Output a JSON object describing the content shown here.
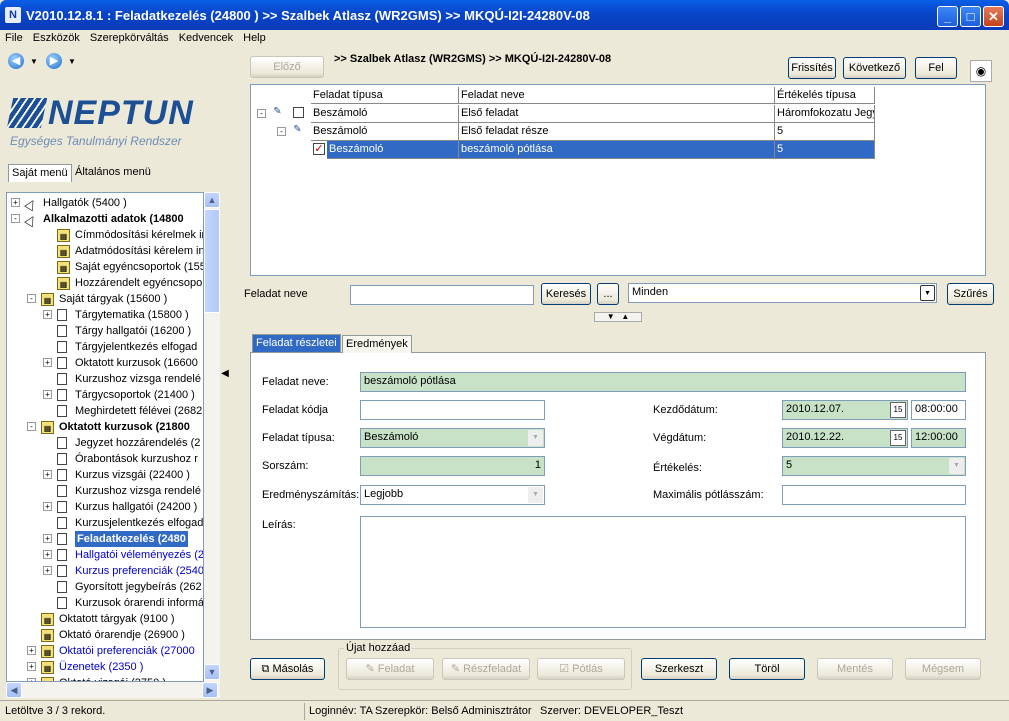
{
  "window": {
    "title": "V2010.12.8.1 : Feladatkezelés (24800  )  >> Szalbek Atlasz (WR2GMS) >> MKQÚ-I2I-24280V-08",
    "app_icon": "N",
    "controls": {
      "minimize": "_",
      "maximize": "□",
      "close": "✕"
    }
  },
  "menubar": [
    "File",
    "Eszközök",
    "Szerepkörváltás",
    "Kedvencek",
    "Help"
  ],
  "logo": {
    "name": "NEPTUN",
    "tagline": "Egységes Tanulmányi Rendszer"
  },
  "left_tabs": [
    "Saját menü",
    "Általános menü"
  ],
  "tree": [
    {
      "text": "Hallgatók (5400  )",
      "level": 0,
      "pm": "+",
      "icon": "book",
      "style": ""
    },
    {
      "text": "Alkalmazotti adatok (14800",
      "level": 0,
      "pm": "-",
      "icon": "book",
      "style": "bold"
    },
    {
      "text": "Címmódosítási kérelmek indít",
      "level": 2,
      "pm": "",
      "icon": "key",
      "style": ""
    },
    {
      "text": "Adatmódosítási kérelem indít",
      "level": 2,
      "pm": "",
      "icon": "key",
      "style": ""
    },
    {
      "text": "Saját egyéncsoportok (15500",
      "level": 2,
      "pm": "",
      "icon": "key",
      "style": ""
    },
    {
      "text": "Hozzárendelt egyéncsoportok",
      "level": 2,
      "pm": "",
      "icon": "key",
      "style": ""
    },
    {
      "text": "Saját tárgyak (15600  )",
      "level": 1,
      "pm": "-",
      "icon": "key",
      "style": ""
    },
    {
      "text": "Tárgytematika (15800  )",
      "level": 2,
      "pm": "+",
      "icon": "doc",
      "style": ""
    },
    {
      "text": "Tárgy hallgatói (16200  )",
      "level": 2,
      "pm": "",
      "icon": "doc",
      "style": ""
    },
    {
      "text": "Tárgyjelentkezés elfogad",
      "level": 2,
      "pm": "",
      "icon": "doc",
      "style": ""
    },
    {
      "text": "Oktatott kurzusok (16600",
      "level": 2,
      "pm": "+",
      "icon": "doc",
      "style": ""
    },
    {
      "text": "Kurzushoz vizsga rendelé",
      "level": 2,
      "pm": "",
      "icon": "doc",
      "style": ""
    },
    {
      "text": "Tárgycsoportok (21400  )",
      "level": 2,
      "pm": "+",
      "icon": "doc",
      "style": ""
    },
    {
      "text": "Meghirdetett félévei (2682",
      "level": 2,
      "pm": "",
      "icon": "doc",
      "style": ""
    },
    {
      "text": "Oktatott kurzusok (21800",
      "level": 1,
      "pm": "-",
      "icon": "key",
      "style": "bold"
    },
    {
      "text": "Jegyzet hozzárendelés (2",
      "level": 2,
      "pm": "",
      "icon": "doc",
      "style": ""
    },
    {
      "text": "Órabontások kurzushoz r",
      "level": 2,
      "pm": "",
      "icon": "doc",
      "style": ""
    },
    {
      "text": "Kurzus vizsgái (22400  )",
      "level": 2,
      "pm": "+",
      "icon": "doc",
      "style": ""
    },
    {
      "text": "Kurzushoz vizsga rendelé",
      "level": 2,
      "pm": "",
      "icon": "doc",
      "style": ""
    },
    {
      "text": "Kurzus hallgatói (24200  )",
      "level": 2,
      "pm": "+",
      "icon": "doc",
      "style": ""
    },
    {
      "text": "Kurzusjelentkezés elfogad",
      "level": 2,
      "pm": "",
      "icon": "doc",
      "style": ""
    },
    {
      "text": "Feladatkezelés (2480",
      "level": 2,
      "pm": "+",
      "icon": "doc",
      "style": "hl"
    },
    {
      "text": "Hallgatói véleményezés (2",
      "level": 2,
      "pm": "+",
      "icon": "doc",
      "style": "blue"
    },
    {
      "text": "Kurzus preferenciák (2540",
      "level": 2,
      "pm": "+",
      "icon": "doc",
      "style": "blue"
    },
    {
      "text": "Gyorsított jegybeírás (262",
      "level": 2,
      "pm": "",
      "icon": "doc",
      "style": ""
    },
    {
      "text": "Kurzusok órarendi informá",
      "level": 2,
      "pm": "",
      "icon": "doc",
      "style": ""
    },
    {
      "text": "Oktatott tárgyak (9100  )",
      "level": 1,
      "pm": "",
      "icon": "key",
      "style": ""
    },
    {
      "text": "Oktató órarendje (26900  )",
      "level": 1,
      "pm": "",
      "icon": "key",
      "style": ""
    },
    {
      "text": "Oktatói preferenciák (27000",
      "level": 1,
      "pm": "+",
      "icon": "key",
      "style": "blue"
    },
    {
      "text": "Üzenetek (2350  )",
      "level": 1,
      "pm": "+",
      "icon": "key",
      "style": "blue"
    },
    {
      "text": "Oktató vizsgái (2750  )",
      "level": 1,
      "pm": "+",
      "icon": "key",
      "style": ""
    }
  ],
  "toolbar": {
    "prev": "Előző",
    "breadcrumb": ">> Szalbek Atlasz (WR2GMS) >> MKQÚ-I2I-24280V-08",
    "refresh": "Frissítés",
    "next": "Következő",
    "up": "Fel"
  },
  "grid": {
    "headers": [
      "Feladat típusa",
      "Feladat neve",
      "Értékelés típusa"
    ],
    "rows": [
      {
        "type": "Beszámoló",
        "name": "Első feladat",
        "eval": "Háromfokozatu Jegy",
        "selected": false
      },
      {
        "type": "Beszámoló",
        "name": "Első feladat része",
        "eval": "5",
        "selected": false
      },
      {
        "type": "Beszámoló",
        "name": "beszámoló pótlása",
        "eval": "5",
        "selected": true
      }
    ]
  },
  "filter": {
    "label": "Feladat neve",
    "value": "",
    "search": "Keresés",
    "ellipsis": "...",
    "scope": "Minden",
    "filter_btn": "Szűrés"
  },
  "detail_tabs": [
    "Feladat részletei",
    "Eredmények"
  ],
  "form": {
    "name_label": "Feladat neve:",
    "name_value": "beszámoló pótlása",
    "code_label": "Feladat kódja",
    "code_value": "",
    "type_label": "Feladat típusa:",
    "type_value": "Beszámoló",
    "order_label": "Sorszám:",
    "order_value": "1",
    "calc_label": "Eredményszámítás:",
    "calc_value": "Legjobb",
    "desc_label": "Leírás:",
    "desc_value": "",
    "start_label": "Kezdődátum:",
    "start_date": "2010.12.07.",
    "start_time": "08:00:00",
    "end_label": "Végdátum:",
    "end_date": "2010.12.22.",
    "end_time": "12:00:00",
    "eval_label": "Értékelés:",
    "eval_value": "5",
    "max_label": "Maximális pótlásszám:",
    "max_value": "",
    "cal_icon": "15"
  },
  "bottom": {
    "copy": "Másolás",
    "group_label": "Újat hozzáad",
    "task": "Feladat",
    "subtask": "Részfeladat",
    "makeup": "Pótlás",
    "edit": "Szerkeszt",
    "delete": "Töröl",
    "save": "Mentés",
    "cancel": "Mégsem"
  },
  "status": {
    "records": "Letöltve 3 / 3 rekord.",
    "login": "Loginnév: TA",
    "role": "Szerepkör: Belső Adminisztrátor",
    "server": "Szerver: DEVELOPER_Teszt"
  }
}
